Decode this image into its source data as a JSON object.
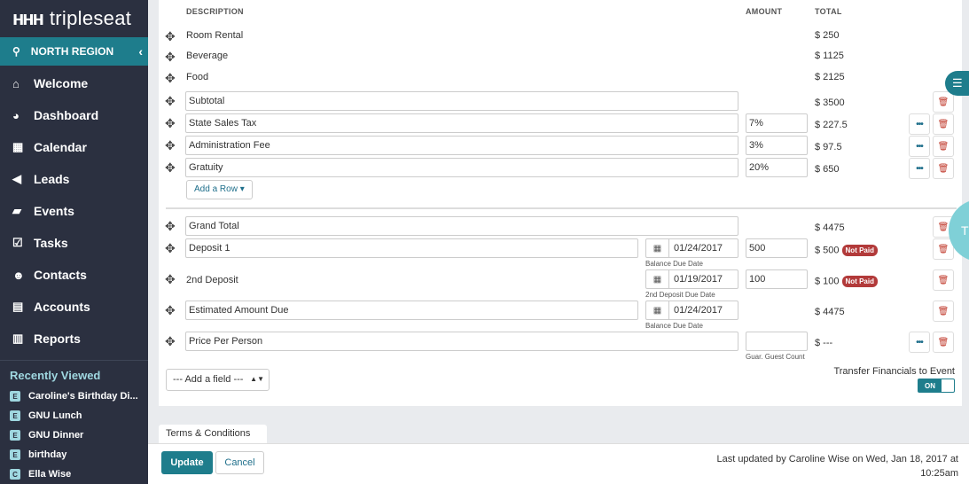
{
  "sidebar": {
    "brand": "tripleseat",
    "brand_mark": "ннн",
    "region": "NORTH REGION",
    "nav": [
      {
        "label": "Welcome",
        "icon": "home-icon"
      },
      {
        "label": "Dashboard",
        "icon": "dashboard-icon"
      },
      {
        "label": "Calendar",
        "icon": "calendar-icon"
      },
      {
        "label": "Leads",
        "icon": "megaphone-icon"
      },
      {
        "label": "Events",
        "icon": "book-icon"
      },
      {
        "label": "Tasks",
        "icon": "checkbox-icon"
      },
      {
        "label": "Contacts",
        "icon": "users-icon"
      },
      {
        "label": "Accounts",
        "icon": "building-icon"
      },
      {
        "label": "Reports",
        "icon": "bar-chart-icon"
      }
    ],
    "recently_viewed_title": "Recently Viewed",
    "recently_viewed": [
      {
        "badge": "E",
        "label": "Caroline's Birthday Di..."
      },
      {
        "badge": "E",
        "label": "GNU Lunch"
      },
      {
        "badge": "E",
        "label": "GNU Dinner"
      },
      {
        "badge": "E",
        "label": "birthday"
      },
      {
        "badge": "C",
        "label": "Ella Wise"
      }
    ]
  },
  "table": {
    "headers": {
      "description": "DESCRIPTION",
      "amount": "AMOUNT",
      "total": "TOTAL"
    },
    "static_rows": [
      {
        "description": "Room Rental",
        "total": "$ 250"
      },
      {
        "description": "Beverage",
        "total": "$ 1125"
      },
      {
        "description": "Food",
        "total": "$ 2125"
      }
    ],
    "subtotal": {
      "description": "Subtotal",
      "total": "$ 3500"
    },
    "adjustments": [
      {
        "description": "State Sales Tax",
        "amount": "7%",
        "total": "$ 227.5"
      },
      {
        "description": "Administration Fee",
        "amount": "3%",
        "total": "$ 97.5"
      },
      {
        "description": "Gratuity",
        "amount": "20%",
        "total": "$ 650"
      }
    ],
    "add_row_label": "Add a Row ▾",
    "grand_total": {
      "description": "Grand Total",
      "total": "$ 4475"
    },
    "deposit1": {
      "description": "Deposit 1",
      "date": "01/24/2017",
      "date_label": "Balance Due Date",
      "amount": "500",
      "total": "$ 500",
      "status": "Not Paid"
    },
    "deposit2": {
      "description": "2nd Deposit",
      "date": "01/19/2017",
      "date_label": "2nd Deposit Due Date",
      "amount": "100",
      "total": "$ 100",
      "status": "Not Paid"
    },
    "estimated": {
      "description": "Estimated Amount Due",
      "date": "01/24/2017",
      "date_label": "Balance Due Date",
      "total": "$ 4475"
    },
    "price_per_person": {
      "description": "Price Per Person",
      "amount_label": "Guar. Guest Count",
      "total": "$ ---"
    },
    "add_field_label": "--- Add a field ---",
    "transfer_label": "Transfer Financials to Event",
    "toggle_label": "ON"
  },
  "footer": {
    "terms_tab": "Terms & Conditions",
    "update": "Update",
    "cancel": "Cancel",
    "updated_line1": "Last updated by Caroline Wise on Wed, Jan 18, 2017 at",
    "updated_line2": "10:25am"
  },
  "side_fab_letter": "T"
}
